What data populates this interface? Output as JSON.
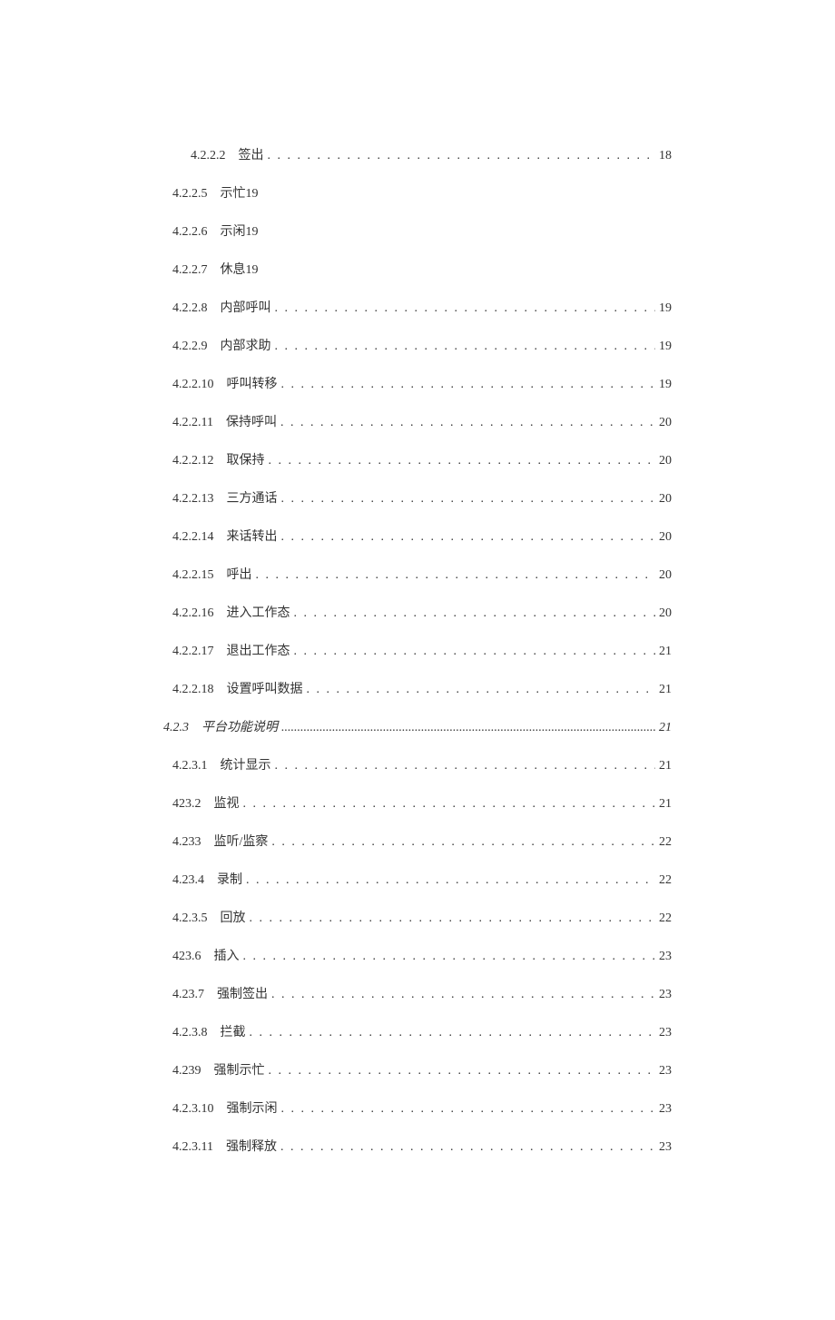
{
  "entries": [
    {
      "num": "4.2.2.2",
      "title": "签出",
      "page": "18",
      "indent": 2,
      "dots": true
    },
    {
      "num": "4.2.2.5",
      "title": "示忙19",
      "page": "",
      "indent": 3,
      "dots": false
    },
    {
      "num": "4.2.2.6",
      "title": "示闲19",
      "page": "",
      "indent": 3,
      "dots": false
    },
    {
      "num": "4.2.2.7",
      "title": "休息19",
      "page": "",
      "indent": 3,
      "dots": false
    },
    {
      "num": "4.2.2.8",
      "title": "内部呼叫",
      "page": "19",
      "indent": 3,
      "dots": true
    },
    {
      "num": "4.2.2.9",
      "title": "内部求助",
      "page": "19",
      "indent": 3,
      "dots": true
    },
    {
      "num": "4.2.2.10",
      "title": "呼叫转移",
      "page": "19",
      "indent": 3,
      "dots": true
    },
    {
      "num": "4.2.2.11",
      "title": "保持呼叫",
      "page": "20",
      "indent": 3,
      "dots": true
    },
    {
      "num": "4.2.2.12",
      "title": "取保持",
      "page": "20",
      "indent": 3,
      "dots": true
    },
    {
      "num": "4.2.2.13",
      "title": "三方通话",
      "page": "20",
      "indent": 3,
      "dots": true
    },
    {
      "num": "4.2.2.14",
      "title": "来话转出",
      "page": "20",
      "indent": 3,
      "dots": true
    },
    {
      "num": "4.2.2.15",
      "title": "呼出",
      "page": "20",
      "indent": 3,
      "dots": true
    },
    {
      "num": "4.2.2.16",
      "title": "进入工作态",
      "page": "20",
      "indent": 3,
      "dots": true
    },
    {
      "num": "4.2.2.17",
      "title": "退出工作态",
      "page": "21",
      "indent": 3,
      "dots": true
    },
    {
      "num": "4.2.2.18",
      "title": "设置呼叫数据",
      "page": "21",
      "indent": 3,
      "dots": true
    },
    {
      "num": "4.2.3",
      "title": "平台功能说明",
      "page": "21",
      "indent": 1,
      "dots": true,
      "section": true
    },
    {
      "num": "4.2.3.1",
      "title": "统计显示",
      "page": "21",
      "indent": 3,
      "dots": true
    },
    {
      "num": "423.2",
      "title": "监视",
      "page": "21",
      "indent": 3,
      "dots": true,
      "tight": true
    },
    {
      "num": "4.233",
      "title": "监听/监察",
      "page": "22",
      "indent": 3,
      "dots": true,
      "tight": true
    },
    {
      "num": "4.23.4",
      "title": "录制",
      "page": "22",
      "indent": 3,
      "dots": true
    },
    {
      "num": "4.2.3.5",
      "title": "回放",
      "page": "22",
      "indent": 3,
      "dots": true
    },
    {
      "num": "423.6",
      "title": "插入",
      "page": "23",
      "indent": 3,
      "dots": true
    },
    {
      "num": "4.23.7",
      "title": "强制签出",
      "page": "23",
      "indent": 3,
      "dots": true,
      "tight": true
    },
    {
      "num": "4.2.3.8",
      "title": "拦截",
      "page": "23",
      "indent": 3,
      "dots": true
    },
    {
      "num": "4.239",
      "title": "强制示忙",
      "page": "23",
      "indent": 3,
      "dots": true,
      "tight": true
    },
    {
      "num": "4.2.3.10",
      "title": "强制示闲",
      "page": "23",
      "indent": 3,
      "dots": true,
      "tight": true
    },
    {
      "num": "4.2.3.11",
      "title": "强制释放",
      "page": "23",
      "indent": 3,
      "dots": true,
      "tight": true
    }
  ]
}
